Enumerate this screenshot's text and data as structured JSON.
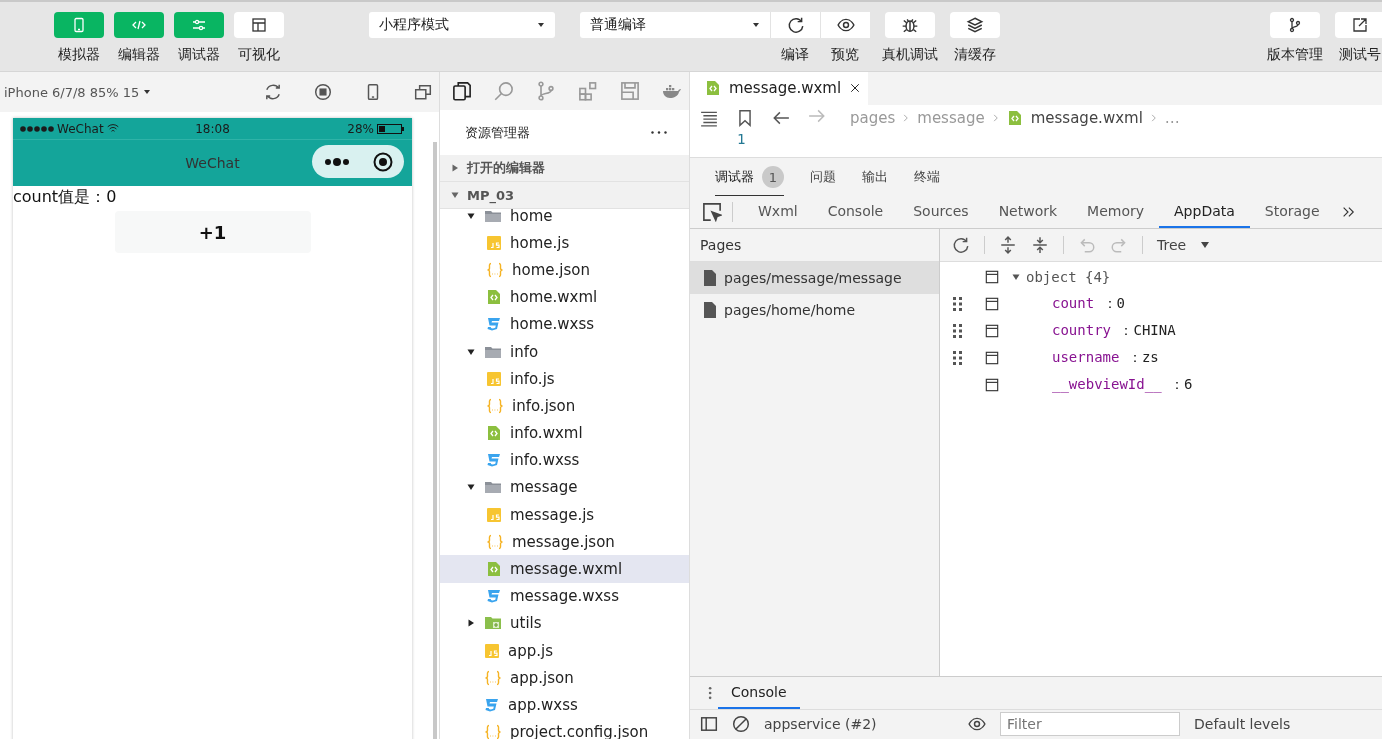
{
  "toolbar": {
    "left_buttons": [
      {
        "label": "模拟器",
        "kind": "phone",
        "active": true
      },
      {
        "label": "编辑器",
        "kind": "code",
        "active": true
      },
      {
        "label": "调试器",
        "kind": "sliders",
        "active": true
      },
      {
        "label": "可视化",
        "kind": "layout",
        "active": false
      }
    ],
    "mode_select": "小程序模式",
    "compile_select": "普通编译",
    "compile_buttons": [
      {
        "label": "编译",
        "kind": "refresh"
      },
      {
        "label": "预览",
        "kind": "eye"
      }
    ],
    "center_buttons": [
      {
        "label": "真机调试",
        "kind": "bug"
      },
      {
        "label": "清缓存",
        "kind": "layers"
      }
    ],
    "right_buttons": [
      {
        "label": "版本管理",
        "kind": "branch"
      },
      {
        "label": "测试号",
        "kind": "external"
      }
    ]
  },
  "simulator": {
    "device": "iPhone 6/7/8 85% 15",
    "carrier": "WeChat",
    "time": "18:08",
    "battery": "28%",
    "nav_title": "WeChat",
    "count_text": "count值是：0",
    "button": "+1"
  },
  "explorer": {
    "title": "资源管理器",
    "sections": [
      {
        "label": "打开的编辑器",
        "expanded": false
      },
      {
        "label": "MP_03",
        "expanded": true
      }
    ],
    "tree": [
      {
        "name": "home",
        "kind": "folder",
        "expanded": true,
        "selected": false,
        "children": [
          {
            "name": "home.js",
            "kind": "js",
            "selected": false
          },
          {
            "name": "home.json",
            "kind": "json",
            "selected": false
          },
          {
            "name": "home.wxml",
            "kind": "wxml",
            "selected": false
          },
          {
            "name": "home.wxss",
            "kind": "wxss",
            "selected": false
          }
        ]
      },
      {
        "name": "info",
        "kind": "folder",
        "expanded": true,
        "selected": false,
        "children": [
          {
            "name": "info.js",
            "kind": "js",
            "selected": false
          },
          {
            "name": "info.json",
            "kind": "json",
            "selected": false
          },
          {
            "name": "info.wxml",
            "kind": "wxml",
            "selected": false
          },
          {
            "name": "info.wxss",
            "kind": "wxss",
            "selected": false
          }
        ]
      },
      {
        "name": "message",
        "kind": "folder",
        "expanded": true,
        "selected": false,
        "children": [
          {
            "name": "message.js",
            "kind": "js",
            "selected": false
          },
          {
            "name": "message.json",
            "kind": "json",
            "selected": false
          },
          {
            "name": "message.wxml",
            "kind": "wxml",
            "selected": true
          },
          {
            "name": "message.wxss",
            "kind": "wxss",
            "selected": false
          }
        ]
      },
      {
        "name": "utils",
        "kind": "package",
        "expanded": false,
        "selected": false
      },
      {
        "name": "app.js",
        "kind": "js",
        "selected": false
      },
      {
        "name": "app.json",
        "kind": "json",
        "selected": false
      },
      {
        "name": "app.wxss",
        "kind": "wxss",
        "selected": false
      },
      {
        "name": "project.config.json",
        "kind": "json",
        "selected": false
      }
    ]
  },
  "editor": {
    "tab": "message.wxml",
    "breadcrumb": [
      {
        "label": "pages",
        "kind": "folder"
      },
      {
        "label": "message",
        "kind": "folder"
      },
      {
        "label": "message.wxml",
        "kind": "wxml"
      },
      {
        "label": "…",
        "kind": "more"
      }
    ],
    "line_numbers": [
      "1"
    ]
  },
  "devtools": {
    "top_tabs": [
      {
        "label": "调试器",
        "badge": "1",
        "selected": true
      },
      {
        "label": "问题",
        "selected": false
      },
      {
        "label": "输出",
        "selected": false
      },
      {
        "label": "终端",
        "selected": false
      }
    ],
    "panel_tabs": [
      {
        "label": "Wxml",
        "selected": false
      },
      {
        "label": "Console",
        "selected": false
      },
      {
        "label": "Sources",
        "selected": false
      },
      {
        "label": "Network",
        "selected": false
      },
      {
        "label": "Memory",
        "selected": false
      },
      {
        "label": "AppData",
        "selected": true
      },
      {
        "label": "Storage",
        "selected": false
      }
    ],
    "pages_header": "Pages",
    "pages": [
      {
        "label": "pages/message/message",
        "selected": true
      },
      {
        "label": "pages/home/home",
        "selected": false
      }
    ],
    "view_mode": "Tree",
    "data_root": {
      "label": "object",
      "count": "{4}",
      "expanded": true
    },
    "separator": "：",
    "data_entries": [
      {
        "key": "count",
        "value": "0",
        "draggable": true
      },
      {
        "key": "country",
        "value": "CHINA",
        "draggable": true
      },
      {
        "key": "username",
        "value": "zs",
        "draggable": true
      },
      {
        "key": "__webviewId__",
        "value": "6",
        "draggable": false
      }
    ],
    "drawer_tabs": [
      {
        "label": "Console",
        "selected": true
      }
    ],
    "console_context": "appservice (#2)",
    "filter_placeholder": "Filter",
    "levels": "Default levels"
  }
}
